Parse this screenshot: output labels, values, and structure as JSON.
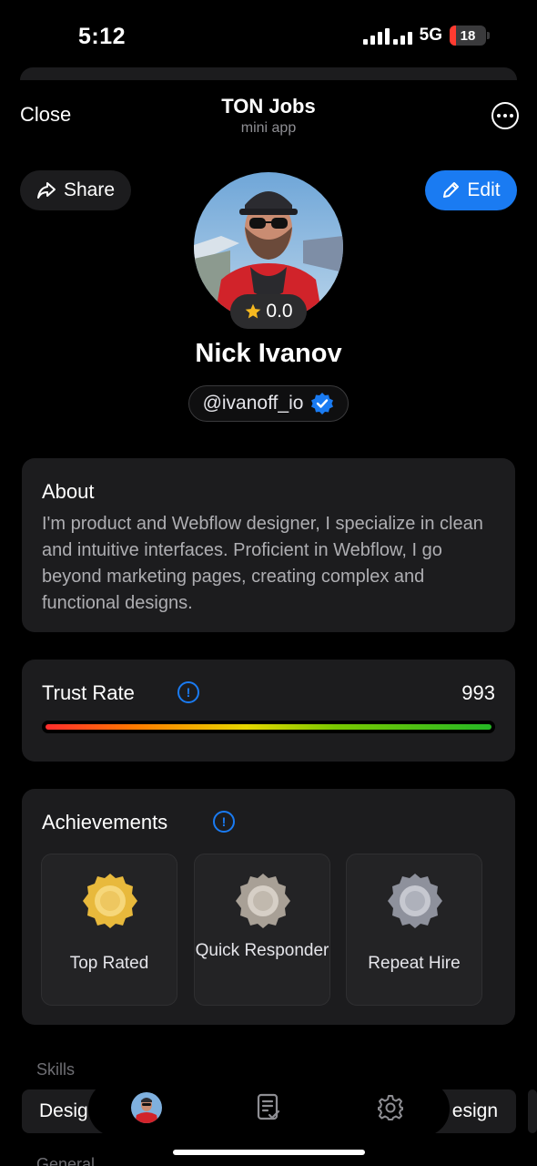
{
  "status_bar": {
    "time": "5:12",
    "network": "5G",
    "battery": "18"
  },
  "header": {
    "close_label": "Close",
    "title": "TON Jobs",
    "subtitle": "mini app",
    "more_icon": "ellipsis-circle-icon"
  },
  "actions": {
    "share_label": "Share",
    "share_icon": "share-arrow-icon",
    "edit_label": "Edit",
    "edit_icon": "pencil-icon",
    "accent": "#1a7bf2"
  },
  "profile": {
    "rating": "0.0",
    "name": "Nick Ivanov",
    "username": "@ivanoff_io",
    "verified": true
  },
  "about": {
    "title": "About",
    "text": "I'm product and Webflow designer, I specialize in clean and intuitive interfaces. Proficient in Webflow, I go beyond marketing pages, creating complex and functional designs."
  },
  "trust": {
    "title": "Trust Rate",
    "value": "993",
    "fill_fraction": 1.0
  },
  "achievements": {
    "title": "Achievements",
    "items": [
      {
        "label": "Top Rated",
        "medal": "gold",
        "color": "#e8b93c"
      },
      {
        "label": "Quick Responder",
        "medal": "bronze",
        "color": "#a8a096"
      },
      {
        "label": "Repeat Hire",
        "medal": "silver",
        "color": "#8e919c"
      }
    ]
  },
  "skills": {
    "title": "Skills",
    "chip_left": "Desig",
    "chip_right": "esign"
  },
  "next_section": {
    "title": "General"
  },
  "tab_bar": {
    "items": [
      "profile-avatar",
      "tasks-icon",
      "settings-gear-icon"
    ]
  }
}
